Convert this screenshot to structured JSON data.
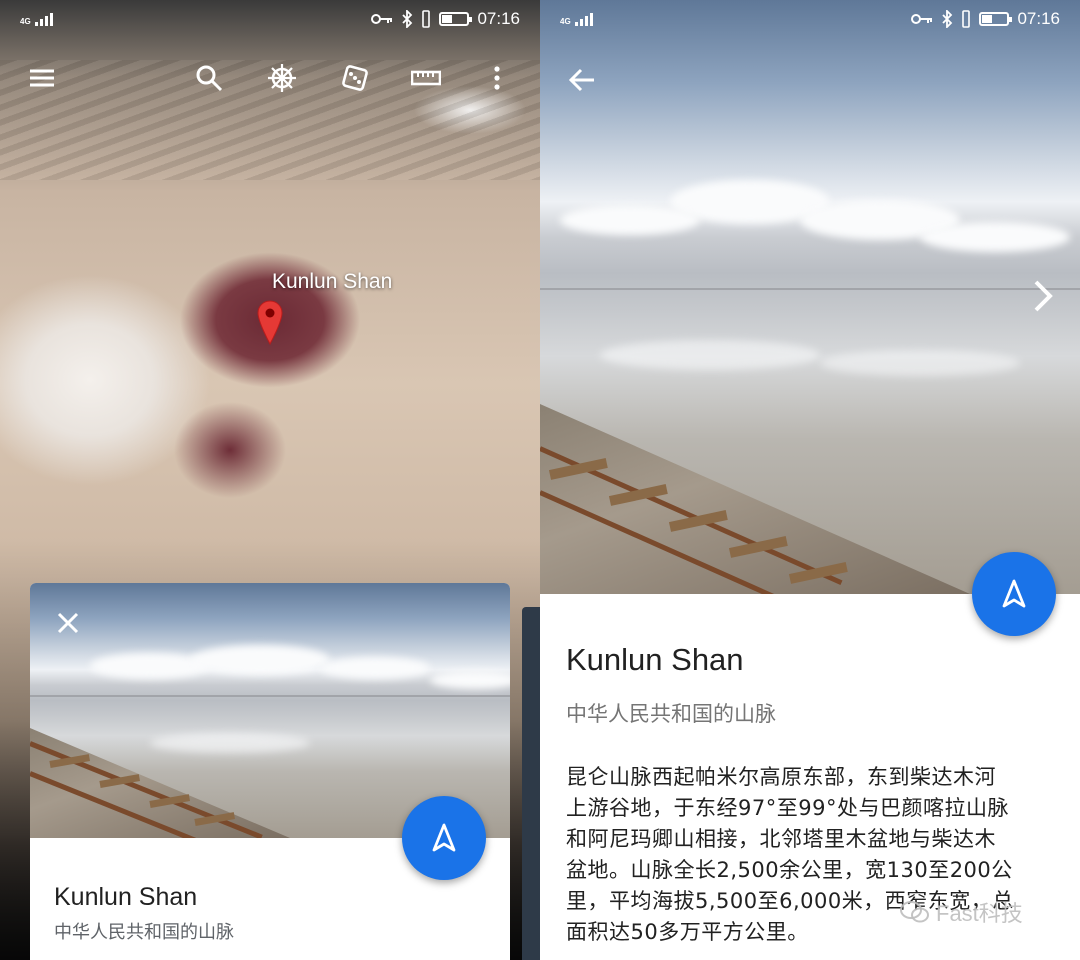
{
  "left_screen": {
    "status_bar": {
      "network": "4G",
      "signal_bars": 4,
      "time": "07:16",
      "battery_level": 0.35
    },
    "toolbar": {
      "menu_icon": "menu-icon",
      "search_icon": "search-icon",
      "voyager_icon": "ship-wheel-icon",
      "feeling_lucky_icon": "dice-icon",
      "measure_icon": "ruler-icon",
      "more_icon": "more-vert-icon"
    },
    "map": {
      "place_label": "Kunlun Shan"
    },
    "card": {
      "title": "Kunlun Shan",
      "subtitle": "中华人民共和国的山脉",
      "close_icon": "close-icon",
      "fab_icon": "navigation-arrow-icon"
    }
  },
  "right_screen": {
    "status_bar": {
      "network": "4G",
      "signal_bars": 4,
      "time": "07:16",
      "battery_level": 0.35
    },
    "back_icon": "back-arrow-icon",
    "next_icon": "chevron-right-icon",
    "fab_icon": "navigation-arrow-icon",
    "detail": {
      "title": "Kunlun Shan",
      "subtitle": "中华人民共和国的山脉",
      "description_lines": [
        "昆仑山脉西起帕米尔高原东部，东到柴达木河",
        "上游谷地，于东经97°至99°处与巴颜喀拉山脉",
        "和阿尼玛卿山相接，北邻塔里木盆地与柴达木",
        "盆地。山脉全长2,500余公里，宽130至200公",
        "里，平均海拔5,500至6,000米，西窄东宽，总",
        "面积达50多万平方公里。"
      ]
    },
    "watermark": "Fast科技"
  },
  "colors": {
    "accent": "#1a73e8",
    "pin": "#e53935"
  }
}
